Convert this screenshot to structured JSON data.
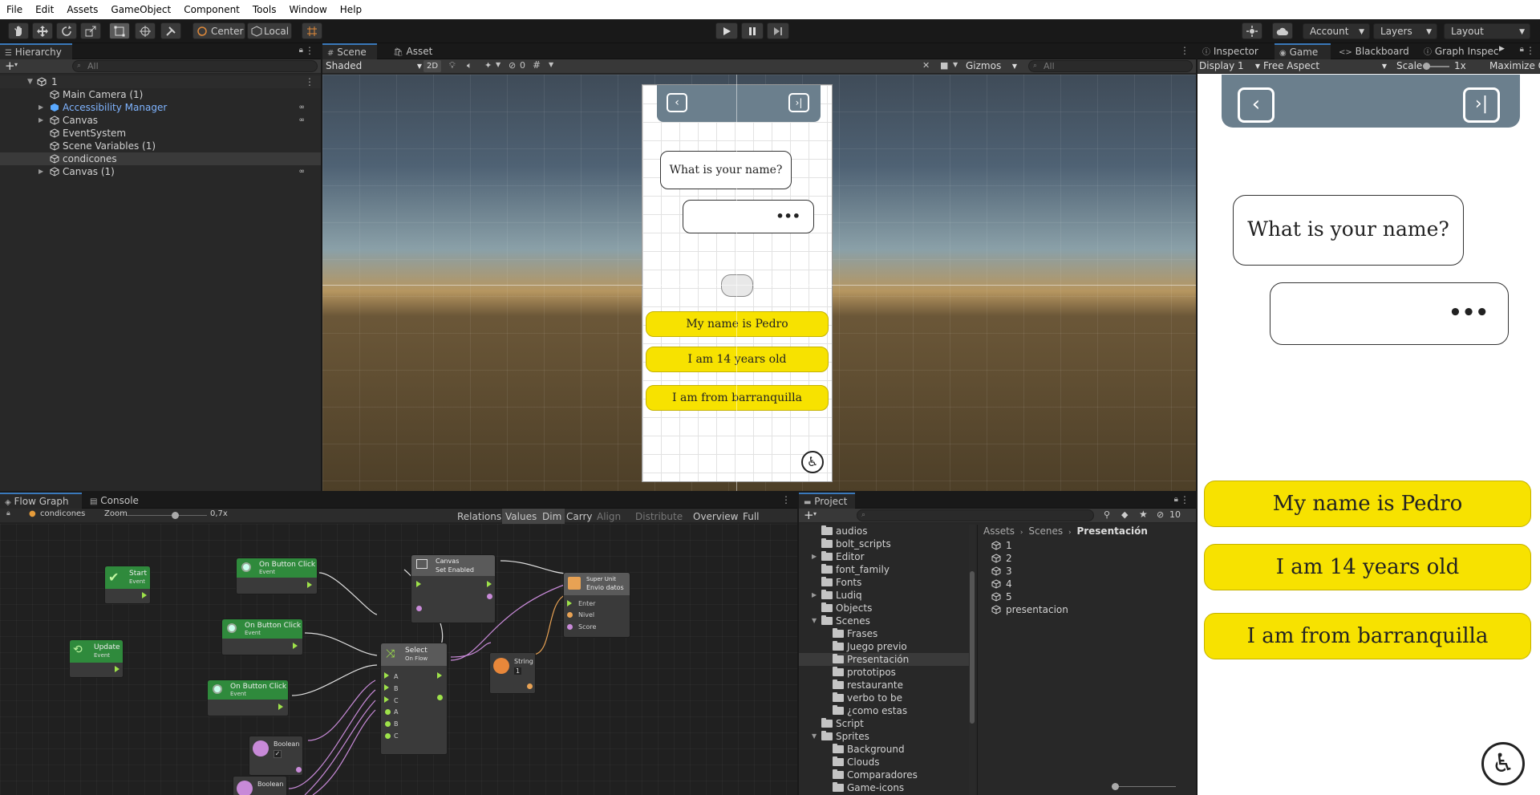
{
  "menu": [
    "File",
    "Edit",
    "Assets",
    "GameObject",
    "Component",
    "Tools",
    "Window",
    "Help"
  ],
  "toolbar": {
    "pivot_center": "Center",
    "pivot_local": "Local",
    "account": "Account",
    "layers": "Layers",
    "layout": "Layout"
  },
  "hierarchy": {
    "tab": "Hierarchy",
    "search_placeholder": "All",
    "scene": "1",
    "items": [
      {
        "label": "Main Camera (1)"
      },
      {
        "label": "Accessibility Manager"
      },
      {
        "label": "Canvas"
      },
      {
        "label": "EventSystem"
      },
      {
        "label": "Scene Variables (1)"
      },
      {
        "label": "condicones"
      },
      {
        "label": "Canvas (1)"
      }
    ]
  },
  "scene_view": {
    "tabs": [
      "Scene",
      "Asset Store"
    ],
    "shading": "Shaded",
    "mode_2d": "2D",
    "hidden_count": "0",
    "gizmos": "Gizmos",
    "search_placeholder": "All",
    "question": "What is your name?",
    "typing": "•••",
    "answers": [
      "My name is Pedro",
      "I am 14 years old",
      "I am from barranquilla"
    ]
  },
  "game_view": {
    "tabs": [
      "Inspector",
      "Game",
      "Blackboard",
      "Graph Inspec"
    ],
    "display": "Display 1",
    "aspect": "Free Aspect",
    "scale_label": "Scale",
    "scale_value": "1x",
    "maximize": "Maximize O",
    "question": "What is your name?",
    "typing": "•••",
    "answers": [
      "My name is Pedro",
      "I am 14 years old",
      "I am from barranquilla"
    ]
  },
  "flow_graph": {
    "tabs": [
      "Flow Graph",
      "Console"
    ],
    "object": "condicones",
    "zoom_label": "Zoom",
    "zoom_value": "0,7x",
    "toolbar": [
      "Relations",
      "Values",
      "Dim",
      "Carry",
      "Align",
      "Distribute",
      "Overview",
      "Full Screen"
    ],
    "nodes": {
      "start": {
        "title": "Start",
        "sub": "Event"
      },
      "update": {
        "title": "Update",
        "sub": "Event"
      },
      "click1": {
        "title": "On Button Click",
        "sub": "Event"
      },
      "click2": {
        "title": "On Button Click",
        "sub": "Event"
      },
      "click3": {
        "title": "On Button Click",
        "sub": "Event"
      },
      "canvas": {
        "title": "Canvas",
        "sub": "Set Enabled"
      },
      "select": {
        "title": "Select",
        "sub": "On Flow",
        "ports": [
          "A",
          "B",
          "C",
          "A",
          "B",
          "C"
        ]
      },
      "string": {
        "title": "String",
        "value": "1"
      },
      "boolean1": {
        "title": "Boolean"
      },
      "boolean2": {
        "title": "Boolean"
      },
      "superunit": {
        "title": "Super Unit",
        "sub": "Envio datos",
        "ports": [
          "Enter",
          "Nivel",
          "Score"
        ]
      }
    }
  },
  "project": {
    "tab": "Project",
    "hidden_count": "10",
    "breadcrumb": [
      "Assets",
      "Scenes",
      "Presentación"
    ],
    "tree": [
      {
        "label": "audios",
        "depth": 0,
        "arrow": ""
      },
      {
        "label": "bolt_scripts",
        "depth": 0,
        "arrow": ""
      },
      {
        "label": "Editor",
        "depth": 0,
        "arrow": "▶"
      },
      {
        "label": "font_family",
        "depth": 0,
        "arrow": ""
      },
      {
        "label": "Fonts",
        "depth": 0,
        "arrow": ""
      },
      {
        "label": "Ludiq",
        "depth": 0,
        "arrow": "▶"
      },
      {
        "label": "Objects",
        "depth": 0,
        "arrow": ""
      },
      {
        "label": "Scenes",
        "depth": 0,
        "arrow": "▼"
      },
      {
        "label": "Frases",
        "depth": 1,
        "arrow": ""
      },
      {
        "label": "Juego previo",
        "depth": 1,
        "arrow": ""
      },
      {
        "label": "Presentación",
        "depth": 1,
        "arrow": ""
      },
      {
        "label": "prototipos",
        "depth": 1,
        "arrow": ""
      },
      {
        "label": "restaurante",
        "depth": 1,
        "arrow": ""
      },
      {
        "label": "verbo to be",
        "depth": 1,
        "arrow": ""
      },
      {
        "label": "¿como estas",
        "depth": 1,
        "arrow": ""
      },
      {
        "label": "Script",
        "depth": 0,
        "arrow": ""
      },
      {
        "label": "Sprites",
        "depth": 0,
        "arrow": "▼"
      },
      {
        "label": "Background",
        "depth": 1,
        "arrow": ""
      },
      {
        "label": "Clouds",
        "depth": 1,
        "arrow": ""
      },
      {
        "label": "Comparadores",
        "depth": 1,
        "arrow": ""
      },
      {
        "label": "Game-icons",
        "depth": 1,
        "arrow": ""
      }
    ],
    "files": [
      "1",
      "2",
      "3",
      "4",
      "5",
      "presentacion"
    ]
  },
  "colors": {
    "accent": "#3a79bb",
    "button_yellow": "#f7e200",
    "node_green": "#2f8a3c",
    "prefab_blue": "#7fb4ff"
  }
}
